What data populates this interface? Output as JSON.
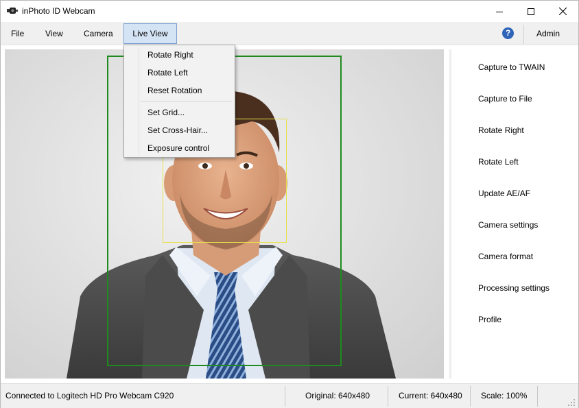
{
  "window": {
    "title": "inPhoto ID Webcam"
  },
  "menubar": {
    "file": "File",
    "view": "View",
    "camera": "Camera",
    "live_view": "Live View",
    "help_glyph": "?",
    "admin": "Admin"
  },
  "live_view_menu": {
    "items": [
      "Rotate Right",
      "Rotate Left",
      "Reset Rotation",
      "Set Grid...",
      "Set Cross-Hair...",
      "Exposure control"
    ]
  },
  "side_panel": {
    "buttons": [
      "Capture to TWAIN",
      "Capture to File",
      "Rotate Right",
      "Rotate Left",
      "Update AE/AF",
      "Camera settings",
      "Camera format",
      "Processing settings",
      "Profile"
    ]
  },
  "statusbar": {
    "connection": "Connected to Logitech HD Pro Webcam C920",
    "original": "Original: 640x480",
    "current": "Current: 640x480",
    "scale": "Scale: 100%"
  },
  "colors": {
    "frame_outer": "#1f8a1f",
    "frame_face": "#e8e04a",
    "help_accent": "#2f64b8",
    "menu_highlight": "#d5e4f5"
  },
  "icons": [
    "webcam-icon",
    "minimize-icon",
    "maximize-icon",
    "close-icon",
    "help-icon",
    "resize-grip-icon"
  ]
}
